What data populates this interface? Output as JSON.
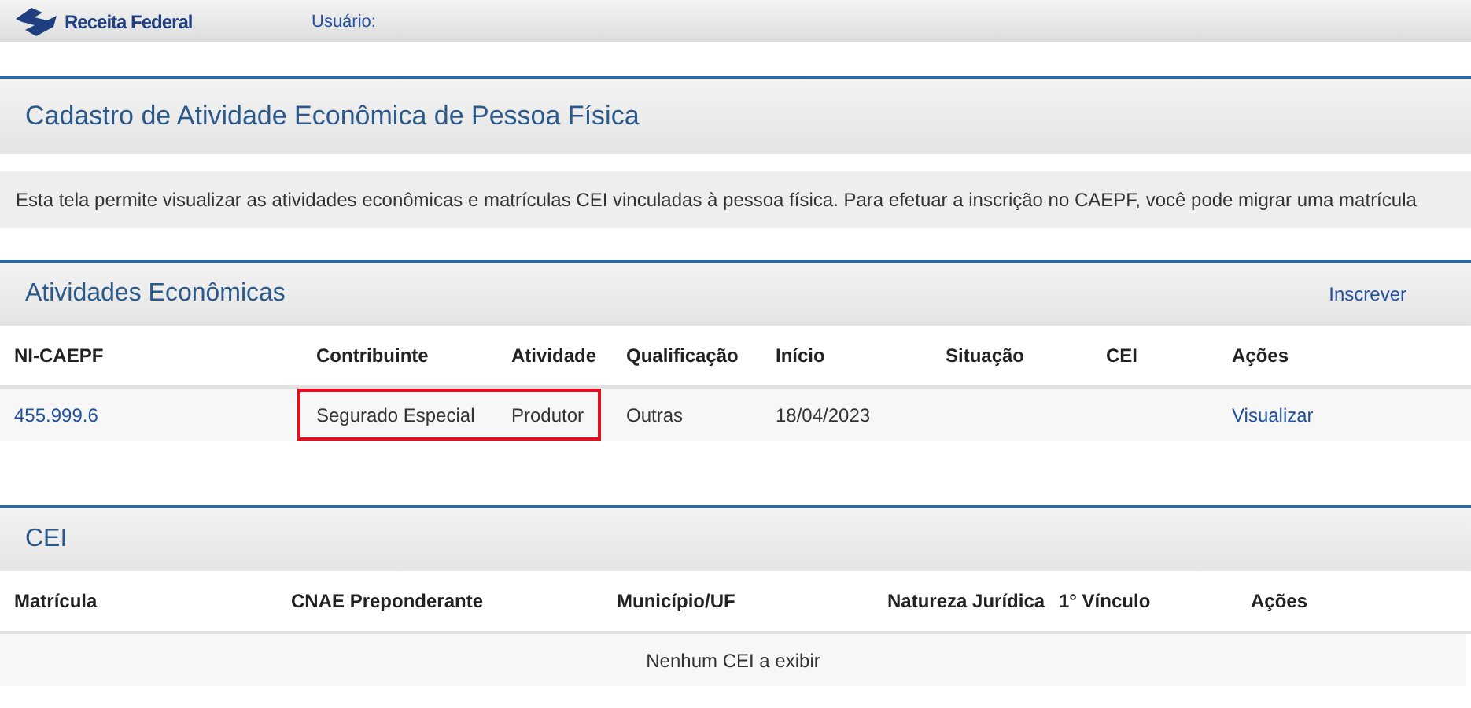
{
  "header": {
    "logo_text": "Receita Federal",
    "user_label": "Usuário:"
  },
  "page_title": "Cadastro de Atividade Econômica de Pessoa Física",
  "description": "Esta tela permite visualizar as atividades econômicas e matrículas CEI vinculadas à pessoa física. Para efetuar a inscrição no CAEPF, você pode migrar uma matrícula",
  "atividades": {
    "title": "Atividades Econômicas",
    "action_link": "Inscrever",
    "columns": [
      "NI-CAEPF",
      "Contribuinte",
      "Atividade",
      "Qualificação",
      "Início",
      "Situação",
      "CEI",
      "Ações"
    ],
    "rows": [
      {
        "cells": [
          {
            "text": "455.999.6",
            "kind": "link",
            "highlighted": false
          },
          {
            "text": "Segurado Especial",
            "kind": "text",
            "highlighted": true
          },
          {
            "text": "Produtor",
            "kind": "text",
            "highlighted": true
          },
          {
            "text": "Outras",
            "kind": "text",
            "highlighted": false
          },
          {
            "text": "18/04/2023",
            "kind": "text",
            "highlighted": false
          },
          {
            "kind": "empty",
            "highlighted": false
          },
          {
            "kind": "empty",
            "highlighted": false
          },
          {
            "text": "Visualizar",
            "kind": "link",
            "highlighted": false
          }
        ]
      }
    ]
  },
  "cei": {
    "title": "CEI",
    "columns": [
      "Matrícula",
      "CNAE Preponderante",
      "Município/UF",
      "Natureza Jurídica",
      "1° Vínculo",
      "Ações"
    ],
    "empty_message": "Nenhum CEI a exibir"
  }
}
